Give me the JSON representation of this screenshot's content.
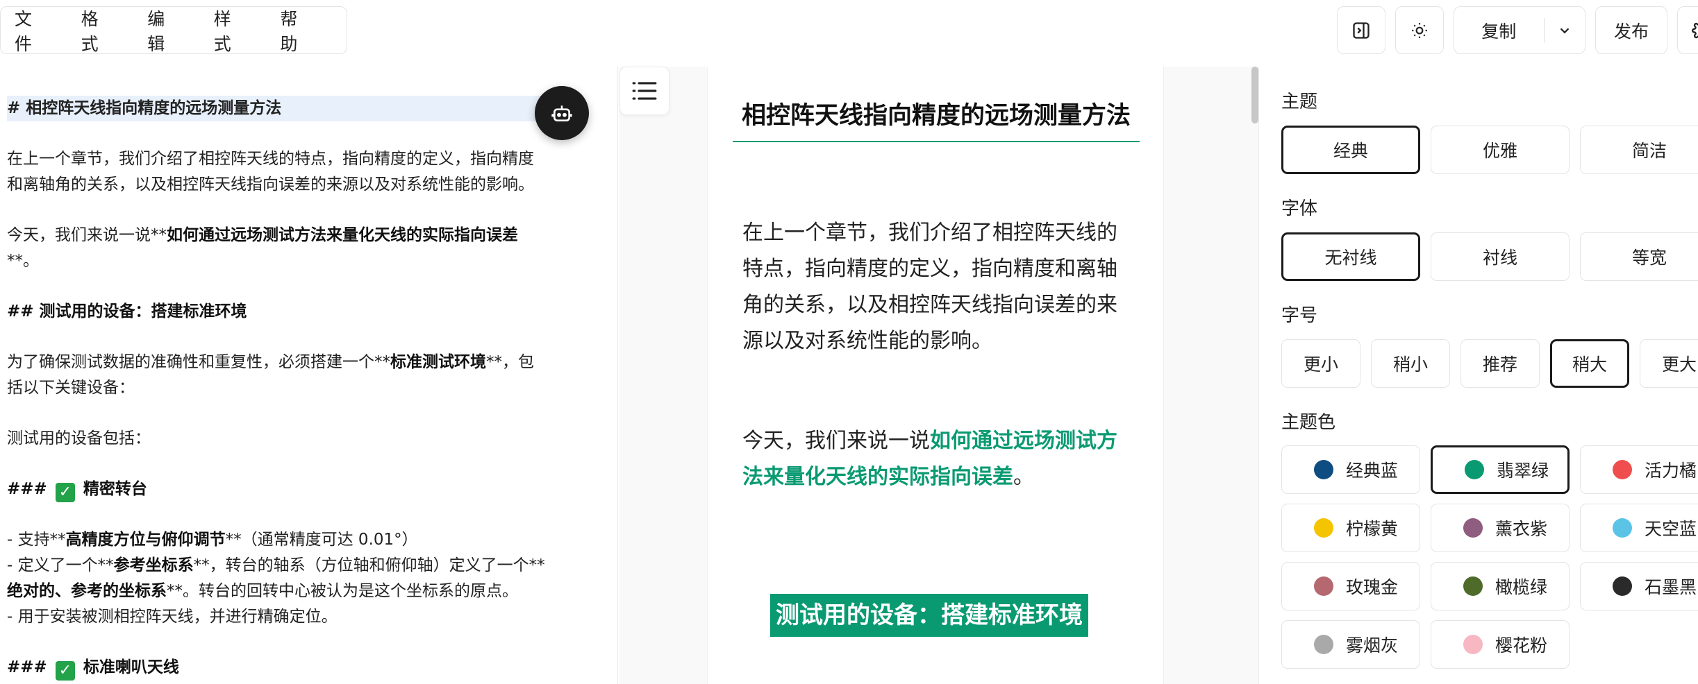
{
  "menu": [
    "文件",
    "格式",
    "编辑",
    "样式",
    "帮助"
  ],
  "toolbar": {
    "copy_label": "复制",
    "publish_label": "发布"
  },
  "editor": {
    "lines": [
      {
        "id": "h1",
        "html": "# 相控阵天线指向精度的远场测量方法"
      },
      {
        "id": "p1a",
        "html": "在上一个章节，我们介绍了相控阵天线的特点，指向精度的定义，指向精度"
      },
      {
        "id": "p1b",
        "html": "和离轴角的关系，以及相控阵天线指向误差的来源以及对系统性能的影响。"
      },
      {
        "id": "p2a",
        "html": "今天，我们来说一说**<b>如何通过远场测试方法来量化天线的实际指向误差</b>"
      },
      {
        "id": "p2b",
        "html": "**。"
      },
      {
        "id": "h2",
        "html": "<b>## 测试用的设备：搭建标准环境</b>"
      },
      {
        "id": "p3a",
        "html": "为了确保测试数据的准确性和重复性，必须搭建一个**<b>标准测试环境</b>**，包"
      },
      {
        "id": "p3b",
        "html": "括以下关键设备："
      },
      {
        "id": "p4",
        "html": "测试用的设备包括："
      },
      {
        "id": "h3a",
        "html": "<b>### <span class='check'>✓</span> 精密转台</b>"
      },
      {
        "id": "l1",
        "html": "- 支持**<b>高精度方位与俯仰调节</b>**（通常精度可达 0.01°）"
      },
      {
        "id": "l2a",
        "html": "- 定义了一个**<b>参考坐标系</b>**，转台的轴系（方位轴和俯仰轴）定义了一个**"
      },
      {
        "id": "l2b",
        "html": "<b>绝对的、参考的坐标系</b>**。转台的回转中心被认为是这个坐标系的原点。"
      },
      {
        "id": "l3",
        "html": "- 用于安装被测相控阵天线，并进行精确定位。"
      },
      {
        "id": "h3b",
        "html": "<b>### <span class='check'>✓</span> 标准喇叭天线</b>"
      }
    ]
  },
  "preview": {
    "title": "相控阵天线指向精度的远场测量方法",
    "para1": "在上一个章节，我们介绍了相控阵天线的特点，指向精度的定义，指向精度和离轴角的关系，以及相控阵天线指向误差的来源以及对系统性能的影响。",
    "para2_prefix": "今天，我们来说一说",
    "para2_highlight": "如何通过远场测试方法来量化天线的实际指向误差",
    "para2_suffix": "。",
    "h2": "测试用的设备：搭建标准环境"
  },
  "panel": {
    "theme": {
      "label": "主题",
      "options": [
        "经典",
        "优雅",
        "简洁"
      ],
      "selected": "经典"
    },
    "font": {
      "label": "字体",
      "options": [
        "无衬线",
        "衬线",
        "等宽"
      ],
      "selected": "无衬线"
    },
    "size": {
      "label": "字号",
      "options": [
        "更小",
        "稍小",
        "推荐",
        "稍大",
        "更大"
      ],
      "selected": "稍大"
    },
    "color": {
      "label": "主题色",
      "selected": "翡翠绿",
      "options": [
        {
          "name": "经典蓝",
          "hex": "#0f4c81"
        },
        {
          "name": "翡翠绿",
          "hex": "#0a9a72"
        },
        {
          "name": "活力橘",
          "hex": "#f04e4e"
        },
        {
          "name": "柠檬黄",
          "hex": "#f5c400"
        },
        {
          "name": "薰衣紫",
          "hex": "#8e5d7f"
        },
        {
          "name": "天空蓝",
          "hex": "#5bc4e6"
        },
        {
          "name": "玫瑰金",
          "hex": "#b5686f"
        },
        {
          "name": "橄榄绿",
          "hex": "#4f6b2a"
        },
        {
          "name": "石墨黑",
          "hex": "#2a2a2a"
        },
        {
          "name": "雾烟灰",
          "hex": "#a9a9a9"
        },
        {
          "name": "樱花粉",
          "hex": "#f7b7c3"
        }
      ]
    }
  }
}
